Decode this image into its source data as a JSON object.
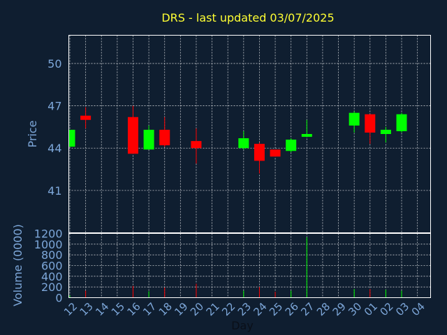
{
  "chart_data": {
    "type": "candlestick",
    "title": "DRS - last updated 03/07/2025",
    "xlabel": "Day",
    "price_panel": {
      "ylabel": "Price",
      "yticks": [
        41,
        44,
        47,
        50
      ],
      "ylim": [
        38,
        52
      ]
    },
    "volume_panel": {
      "ylabel": "Volume (0000)",
      "yticks": [
        0,
        200,
        400,
        600,
        800,
        1000,
        1200
      ],
      "ylim": [
        0,
        1200
      ]
    },
    "x_labels": [
      "12",
      "13",
      "14",
      "15",
      "16",
      "17",
      "18",
      "19",
      "20",
      "21",
      "22",
      "23",
      "24",
      "25",
      "26",
      "27",
      "28",
      "29",
      "30",
      "01",
      "02",
      "03",
      "04"
    ],
    "colors": {
      "up": "#00ff00",
      "down": "#ff0000",
      "background": "#0f1e30",
      "title": "#ffff33",
      "axis": "#7da7d9"
    },
    "candles": [
      {
        "x": "12",
        "open": 44.1,
        "high": 45.3,
        "low": 44.1,
        "close": 45.3,
        "volume": 40
      },
      {
        "x": "13",
        "open": 46.3,
        "high": 46.9,
        "low": 45.4,
        "close": 46.0,
        "volume": 130
      },
      {
        "x": "16",
        "open": 46.2,
        "high": 47.0,
        "low": 43.6,
        "close": 43.6,
        "volume": 220
      },
      {
        "x": "17",
        "open": 43.9,
        "high": 45.6,
        "low": 43.9,
        "close": 45.3,
        "volume": 120
      },
      {
        "x": "18",
        "open": 45.3,
        "high": 46.2,
        "low": 44.1,
        "close": 44.2,
        "volume": 190
      },
      {
        "x": "20",
        "open": 44.5,
        "high": 45.4,
        "low": 42.9,
        "close": 44.0,
        "volume": 260
      },
      {
        "x": "23",
        "open": 44.0,
        "high": 45.2,
        "low": 43.9,
        "close": 44.7,
        "volume": 130
      },
      {
        "x": "24",
        "open": 44.3,
        "high": 44.4,
        "low": 42.2,
        "close": 43.1,
        "volume": 200
      },
      {
        "x": "25",
        "open": 43.9,
        "high": 43.9,
        "low": 43.4,
        "close": 43.4,
        "volume": 110
      },
      {
        "x": "26",
        "open": 43.8,
        "high": 44.7,
        "low": 43.7,
        "close": 44.6,
        "volume": 130
      },
      {
        "x": "27",
        "open": 44.8,
        "high": 46.0,
        "low": 44.8,
        "close": 45.0,
        "volume": 1130
      },
      {
        "x": "30",
        "open": 45.6,
        "high": 46.6,
        "low": 45.1,
        "close": 46.5,
        "volume": 160
      },
      {
        "x": "01",
        "open": 46.4,
        "high": 46.4,
        "low": 44.3,
        "close": 45.1,
        "volume": 160
      },
      {
        "x": "02",
        "open": 45.0,
        "high": 45.5,
        "low": 44.4,
        "close": 45.3,
        "volume": 150
      },
      {
        "x": "03",
        "open": 45.2,
        "high": 46.5,
        "low": 45.1,
        "close": 46.4,
        "volume": 130
      }
    ]
  }
}
